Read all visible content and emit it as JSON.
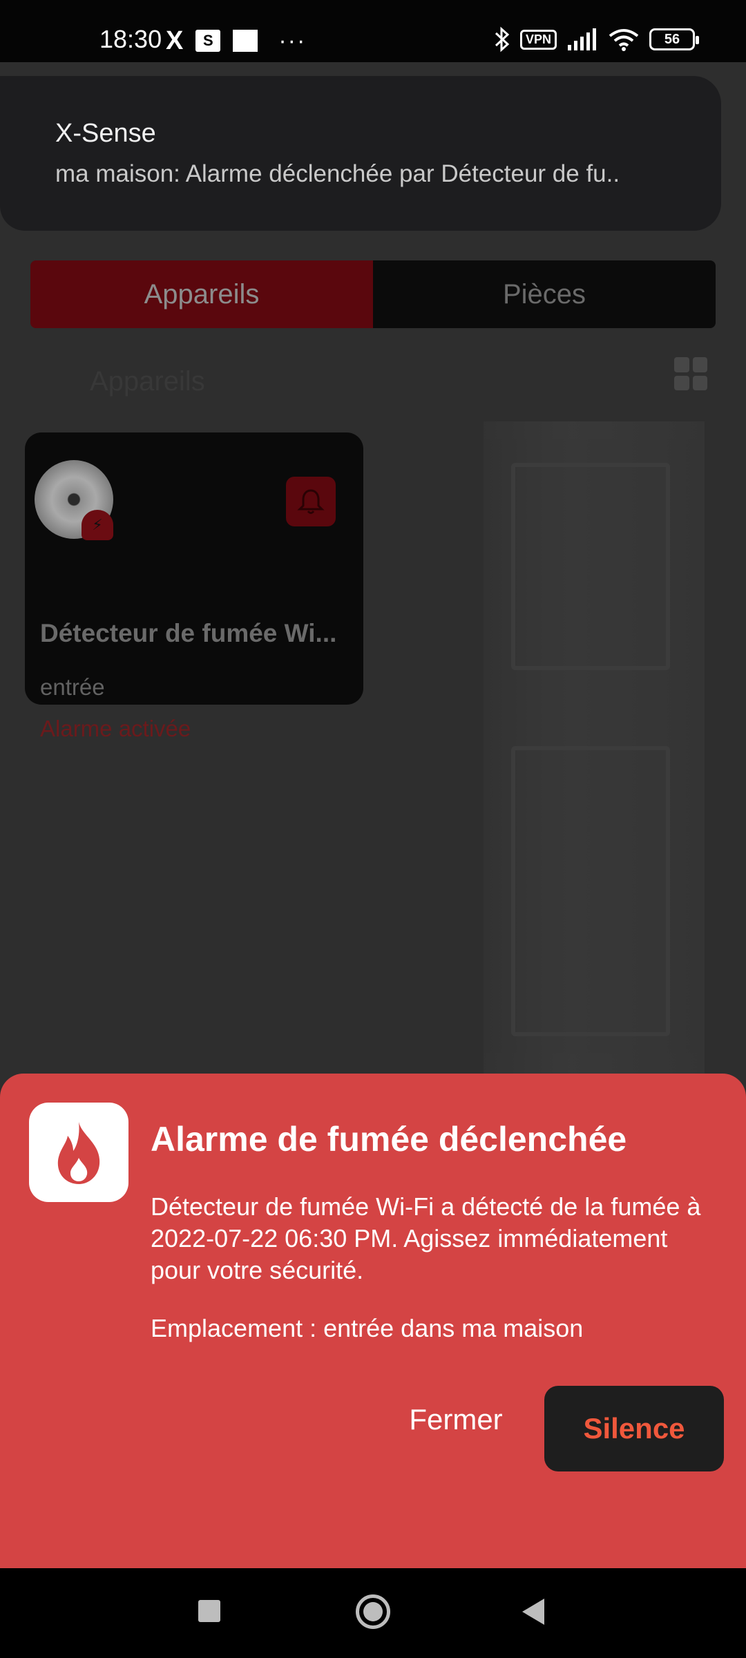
{
  "status_bar": {
    "time": "18:30",
    "x_icon": "X",
    "s_icon": "S",
    "more": "···",
    "vpn": "VPN",
    "battery": "56",
    "icons": [
      "x-app-icon",
      "s-app-icon",
      "square-app-icon",
      "bluetooth-icon",
      "vpn-icon",
      "signal-icon",
      "wifi-icon",
      "battery-icon"
    ]
  },
  "notification": {
    "app_name": "X-Sense",
    "body": "ma maison: Alarme déclenchée par Détecteur de fu.."
  },
  "tabs": {
    "devices": "Appareils",
    "rooms": "Pièces"
  },
  "section": {
    "label": "Appareils"
  },
  "device_card": {
    "name": "Détecteur de fumée Wi...",
    "room": "entrée",
    "status": "Alarme activée"
  },
  "alarm": {
    "title": "Alarme de fumée déclenchée",
    "message": "Détecteur de fumée Wi-Fi a détecté de la fumée à 2022-07-22 06:30 PM. Agissez immédiatement pour votre sécurité.",
    "location": "Emplacement : entrée dans ma maison",
    "close_label": "Fermer",
    "silence_label": "Silence"
  },
  "colors": {
    "alarm_red": "#d44444",
    "silence_text": "#f0583c",
    "button_dark": "#1e1e1e"
  }
}
